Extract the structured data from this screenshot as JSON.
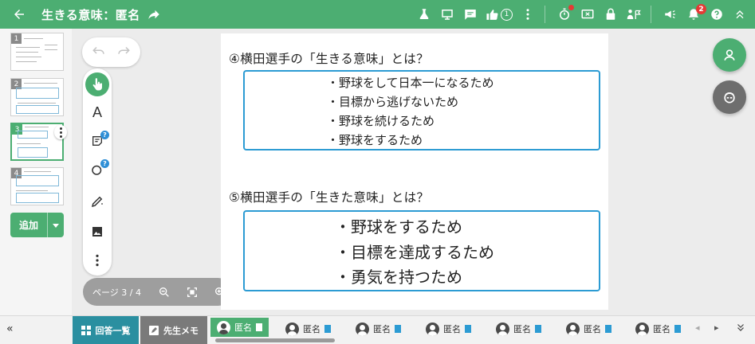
{
  "header": {
    "title": "生きる意味：匿名",
    "thumbs_count": "1",
    "notification_count": "2"
  },
  "sidebar": {
    "pages": [
      {
        "num": "1"
      },
      {
        "num": "2"
      },
      {
        "num": "3"
      },
      {
        "num": "4"
      }
    ],
    "add_label": "追加"
  },
  "tools": {
    "text_tool": "A",
    "sticky_badge": "?",
    "shape_badge": "?"
  },
  "pager": {
    "label": "ページ 3 / 4"
  },
  "worksheet": {
    "q4_title": "④横田選手の「生きる意味」とは？",
    "q4_answers": [
      "・野球をして日本一になるため",
      "・目標から逃げないため",
      "・野球を続けるため",
      "・野球をするため"
    ],
    "q5_title": "⑤横田選手の「生きた意味」とは？",
    "q5_answers": [
      "・野球をするため",
      "・目標を達成するため",
      "・勇気を持つため"
    ]
  },
  "bottombar": {
    "collapse_glyph": "«",
    "answers_tab": "回答一覧",
    "teacher_memo_tab": "先生メモ",
    "students": [
      "匿名",
      "匿名",
      "匿名",
      "匿名",
      "匿名",
      "匿名",
      "匿名"
    ]
  },
  "colors": {
    "brand_green": "#4cae72",
    "answer_border": "#2c9bd3",
    "bottom_tab_teal": "#2a8fa0",
    "bottom_tab_gray": "#7a7a7a"
  }
}
